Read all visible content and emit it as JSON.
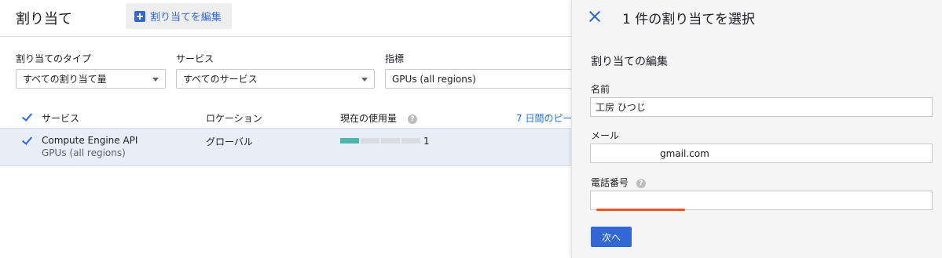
{
  "header": {
    "title": "割り当て",
    "edit_button": "割り当てを編集"
  },
  "filters": {
    "type": {
      "label": "割り当てのタイプ",
      "value": "すべての割り当て量"
    },
    "service": {
      "label": "サービス",
      "value": "すべてのサービス"
    },
    "metric": {
      "label": "指標",
      "value": "GPUs (all regions)"
    }
  },
  "table": {
    "columns": {
      "service": "サービス",
      "location": "ロケーション",
      "current_usage": "現在の使用量",
      "peak": "7 日間のピー"
    },
    "rows": [
      {
        "service": "Compute Engine API",
        "metric": "GPUs (all regions)",
        "location": "グローバル",
        "usage_value": "1",
        "usage_fraction": 0.25,
        "selected": true
      }
    ]
  },
  "panel": {
    "title": "1 件の割り当てを選択",
    "section_title": "割り当ての編集",
    "name": {
      "label": "名前",
      "value": "工房 ひつじ"
    },
    "email": {
      "label": "メール",
      "value": "gmail.com"
    },
    "phone": {
      "label": "電話番号",
      "value": ""
    },
    "next_button": "次へ"
  },
  "colors": {
    "accent": "#3367d6",
    "usage": "#4db6ac",
    "row_selected": "#e8eef8",
    "redaction": "#f4511e"
  }
}
